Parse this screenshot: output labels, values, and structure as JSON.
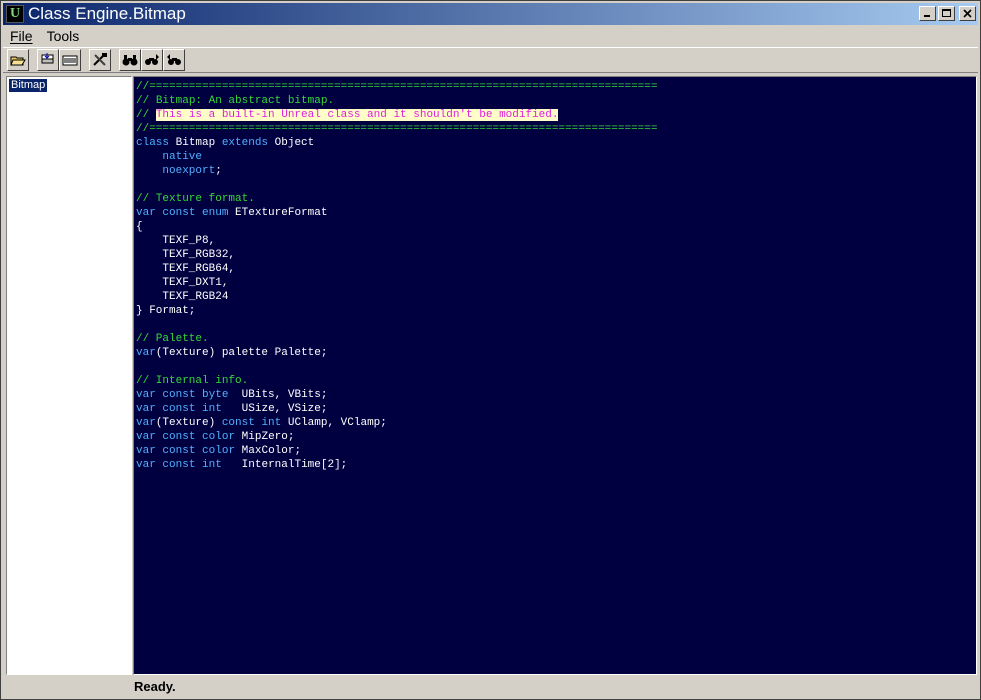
{
  "window": {
    "title": "Class Engine.Bitmap",
    "app_icon": "unreal-u-icon",
    "buttons": [
      "minimize-button",
      "maximize-button",
      "close-button"
    ]
  },
  "menu": {
    "file": "File",
    "tools": "Tools"
  },
  "toolbar": {
    "buttons": [
      "open-icon",
      "compile-icon",
      "compile-all-icon",
      "tools-icon",
      "find-icon",
      "find-next-icon",
      "find-previous-icon"
    ]
  },
  "tree": {
    "selected": "Bitmap"
  },
  "code": {
    "sep": "//=============================================================================",
    "l1_prefix": "// ",
    "l1": "Bitmap: An abstract bitmap.",
    "l2_prefix": "// ",
    "l2_highlight": "This is a built-in Unreal class and it shouldn't be modified.",
    "class_kw": "class",
    "class_name": " Bitmap ",
    "extends_kw": "extends",
    "extends_name": " Object",
    "native_kw": "native",
    "noexport_kw": "noexport",
    "noexport_end": ";",
    "c_texfmt": "// Texture format.",
    "var_kw": "var",
    "const_kw": "const",
    "enum_kw": "enum",
    "enum_name": " ETextureFormat",
    "brace_open": "{",
    "enum_items": [
      "TEXF_P8,",
      "TEXF_RGB32,",
      "TEXF_RGB64,",
      "TEXF_DXT1,",
      "TEXF_RGB24"
    ],
    "brace_close": "} Format;",
    "c_palette": "// Palette.",
    "palette_group": "(Texture) palette Palette;",
    "c_internal": "// Internal info.",
    "byte_kw": "byte",
    "ubits": "  UBits, VBits;",
    "int_kw": "int",
    "usize": "   USize, VSize;",
    "texture_group": "(Texture) ",
    "uclamp": " UClamp, VClamp;",
    "color_kw": "color",
    "mipzero": " MipZero;",
    "maxcolor": " MaxColor;",
    "internaltime": "   InternalTime[2];"
  },
  "status": {
    "text": "Ready."
  },
  "colors": {
    "code_bg": "#000040",
    "keyword": "#4fb0ff",
    "comment": "#36d936",
    "highlight_bg": "#fffdc8",
    "highlight_fg": "#e01fe0"
  }
}
